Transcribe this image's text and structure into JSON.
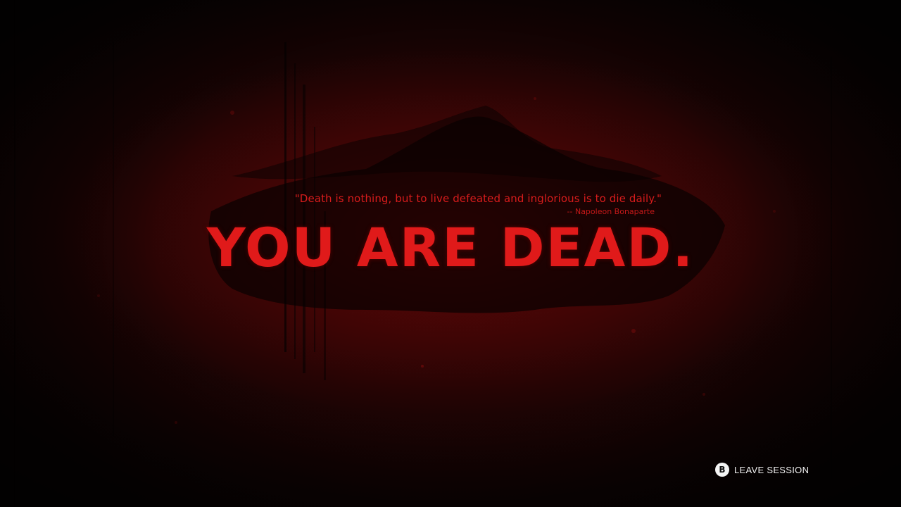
{
  "screen": {
    "quote": "\"Death is nothing, but to live defeated and inglorious is to die daily.\"",
    "attribution": "-- Napoleon Bonaparte",
    "headline": "YOU ARE DEAD."
  },
  "prompt": {
    "button_glyph": "B",
    "button_icon": "b-button-icon",
    "label": "LEAVE SESSION"
  },
  "colors": {
    "accent_red": "#e01a1a",
    "background": "#060303",
    "prompt_text": "#f0f0f0"
  }
}
